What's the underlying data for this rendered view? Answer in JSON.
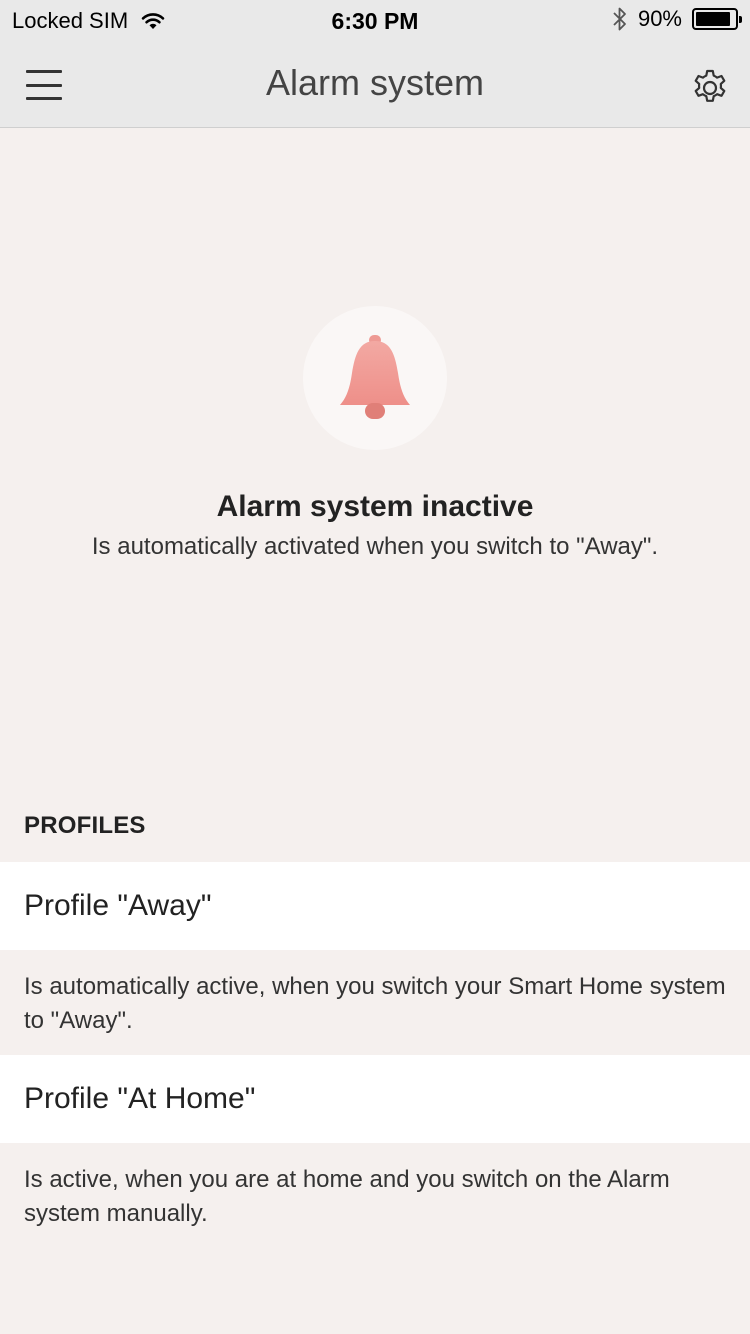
{
  "status_bar": {
    "carrier": "Locked SIM",
    "time": "6:30 PM",
    "battery_percent": "90%",
    "battery_level": 0.9,
    "icons": [
      "wifi-icon",
      "bluetooth-icon",
      "battery-icon"
    ]
  },
  "navbar": {
    "title": "Alarm system",
    "menu_icon": "hamburger-menu-icon",
    "settings_icon": "gear-icon"
  },
  "alarm": {
    "icon": "bell-icon",
    "status_title": "Alarm system inactive",
    "status_subtitle": "Is automatically activated when you switch to \"Away\"."
  },
  "profiles": {
    "header": "PROFILES",
    "items": [
      {
        "label": "Profile \"Away\"",
        "description": "Is automatically active, when you switch your Smart Home system to \"Away\"."
      },
      {
        "label": "Profile \"At Home\"",
        "description": "Is active, when you are at home and you switch on the Alarm system manually."
      }
    ]
  },
  "colors": {
    "background": "#f5f0ee",
    "navbar": "#e9e9e9",
    "bell": "#ef958f",
    "row": "#ffffff"
  }
}
